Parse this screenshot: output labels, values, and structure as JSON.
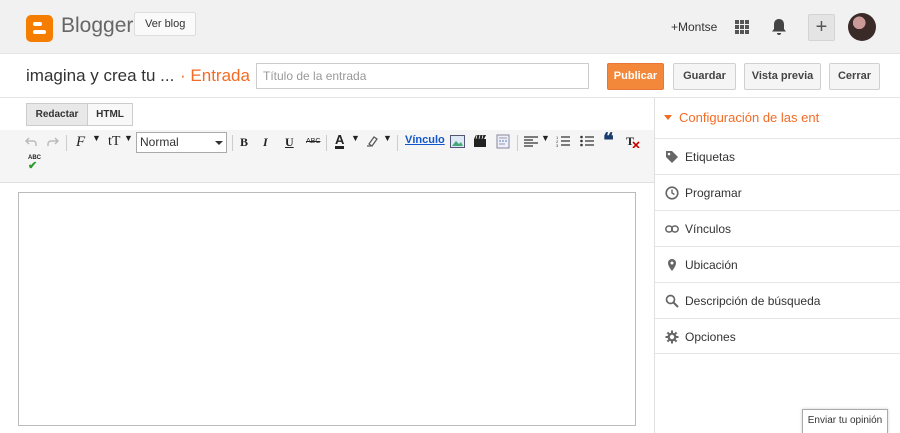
{
  "header": {
    "brand": "Blogger",
    "view_blog_label": "Ver blog",
    "user_link": "+Montse"
  },
  "titlebar": {
    "blog_name": "imagina y crea tu ...",
    "separator": "·",
    "section": "Entrada",
    "title_placeholder": "Título de la entrada",
    "title_value": "",
    "publish_label": "Publicar",
    "save_label": "Guardar",
    "preview_label": "Vista previa",
    "close_label": "Cerrar"
  },
  "editor": {
    "tab_compose": "Redactar",
    "tab_html": "HTML",
    "format_select": "Normal",
    "link_label": "Vínculo",
    "font_glyph": "F",
    "size_glyph": "tT",
    "bold": "B",
    "italic": "I",
    "underline": "U",
    "strike": "ABC",
    "text_color": "A",
    "spell": "ABC"
  },
  "sidebar": {
    "header": "Configuración de las ent",
    "items": [
      {
        "label": "Etiquetas",
        "icon": "tag-icon"
      },
      {
        "label": "Programar",
        "icon": "clock-icon"
      },
      {
        "label": "Vínculos",
        "icon": "link-icon"
      },
      {
        "label": "Ubicación",
        "icon": "location-pin-icon"
      },
      {
        "label": "Descripción de búsqueda",
        "icon": "search-icon"
      },
      {
        "label": "Opciones",
        "icon": "gear-icon"
      }
    ]
  },
  "feedback_label": "Enviar tu opinión",
  "colors": {
    "accent": "#f26b24",
    "publish": "#f4883a",
    "link": "#1155cc"
  }
}
